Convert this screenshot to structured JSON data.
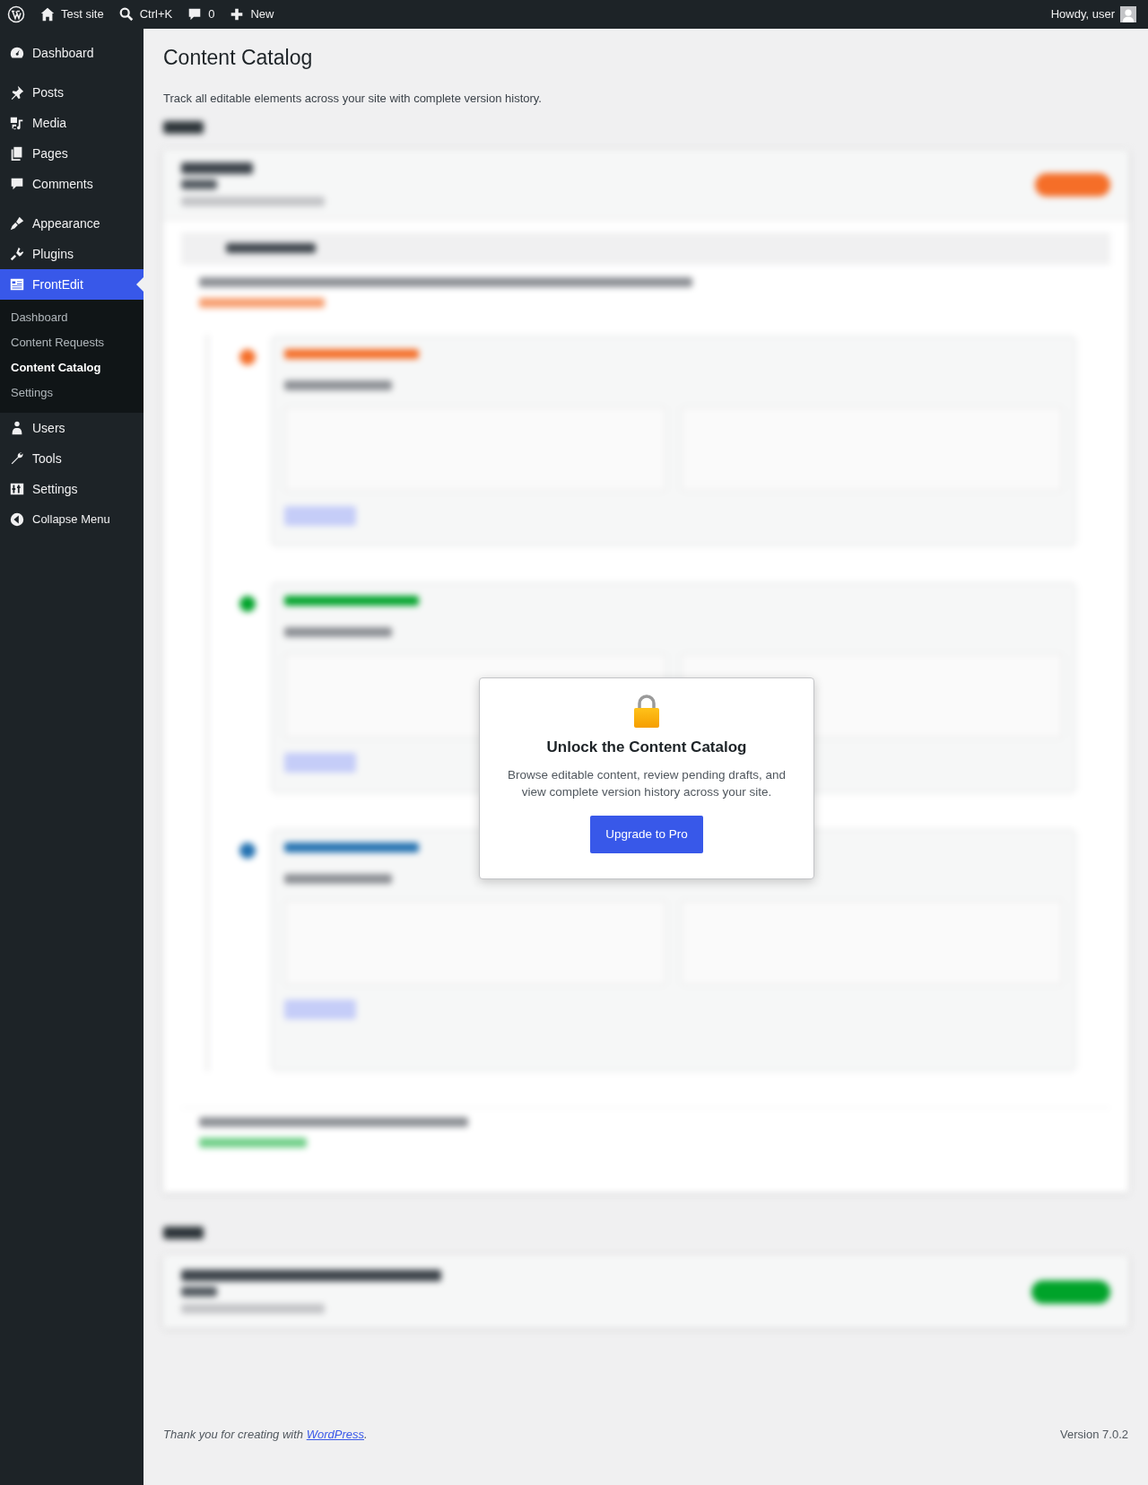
{
  "admin_bar": {
    "site": "Test site",
    "search": "Ctrl+K",
    "comments": "0",
    "new": "New",
    "greeting": "Howdy, user"
  },
  "sidebar": {
    "items": [
      {
        "kind": "dashboard",
        "label": "Dashboard",
        "selected": false
      },
      {
        "kind": "posts",
        "label": "Posts",
        "selected": false
      },
      {
        "kind": "media",
        "label": "Media",
        "selected": false
      },
      {
        "kind": "pages",
        "label": "Pages",
        "selected": false
      },
      {
        "kind": "comments",
        "label": "Comments",
        "selected": false
      },
      {
        "kind": "appearance",
        "label": "Appearance",
        "selected": false
      },
      {
        "kind": "plugins",
        "label": "Plugins",
        "selected": false
      },
      {
        "kind": "frontedit",
        "label": "FrontEdit",
        "selected": true,
        "children": [
          {
            "label": "Dashboard",
            "selected": false
          },
          {
            "label": "Content Requests",
            "selected": false
          },
          {
            "label": "Content Catalog",
            "selected": true
          },
          {
            "label": "Settings",
            "selected": false
          }
        ]
      },
      {
        "kind": "users",
        "label": "Users",
        "selected": false
      },
      {
        "kind": "tools",
        "label": "Tools",
        "selected": false
      },
      {
        "kind": "settings",
        "label": "Settings",
        "selected": false
      }
    ],
    "collapse": "Collapse Menu"
  },
  "page": {
    "title": "Content Catalog",
    "description": "Track all editable elements across your site with complete version history."
  },
  "upgrade_modal": {
    "title": "Unlock the Content Catalog",
    "text": "Browse editable content, review pending drafts, and view complete version history across your site.",
    "button": "Upgrade to Pro"
  },
  "footer": {
    "text_before": "Thank you for creating with ",
    "link": "WordPress",
    "text_after": ".",
    "version": "Version 7.0.2"
  }
}
